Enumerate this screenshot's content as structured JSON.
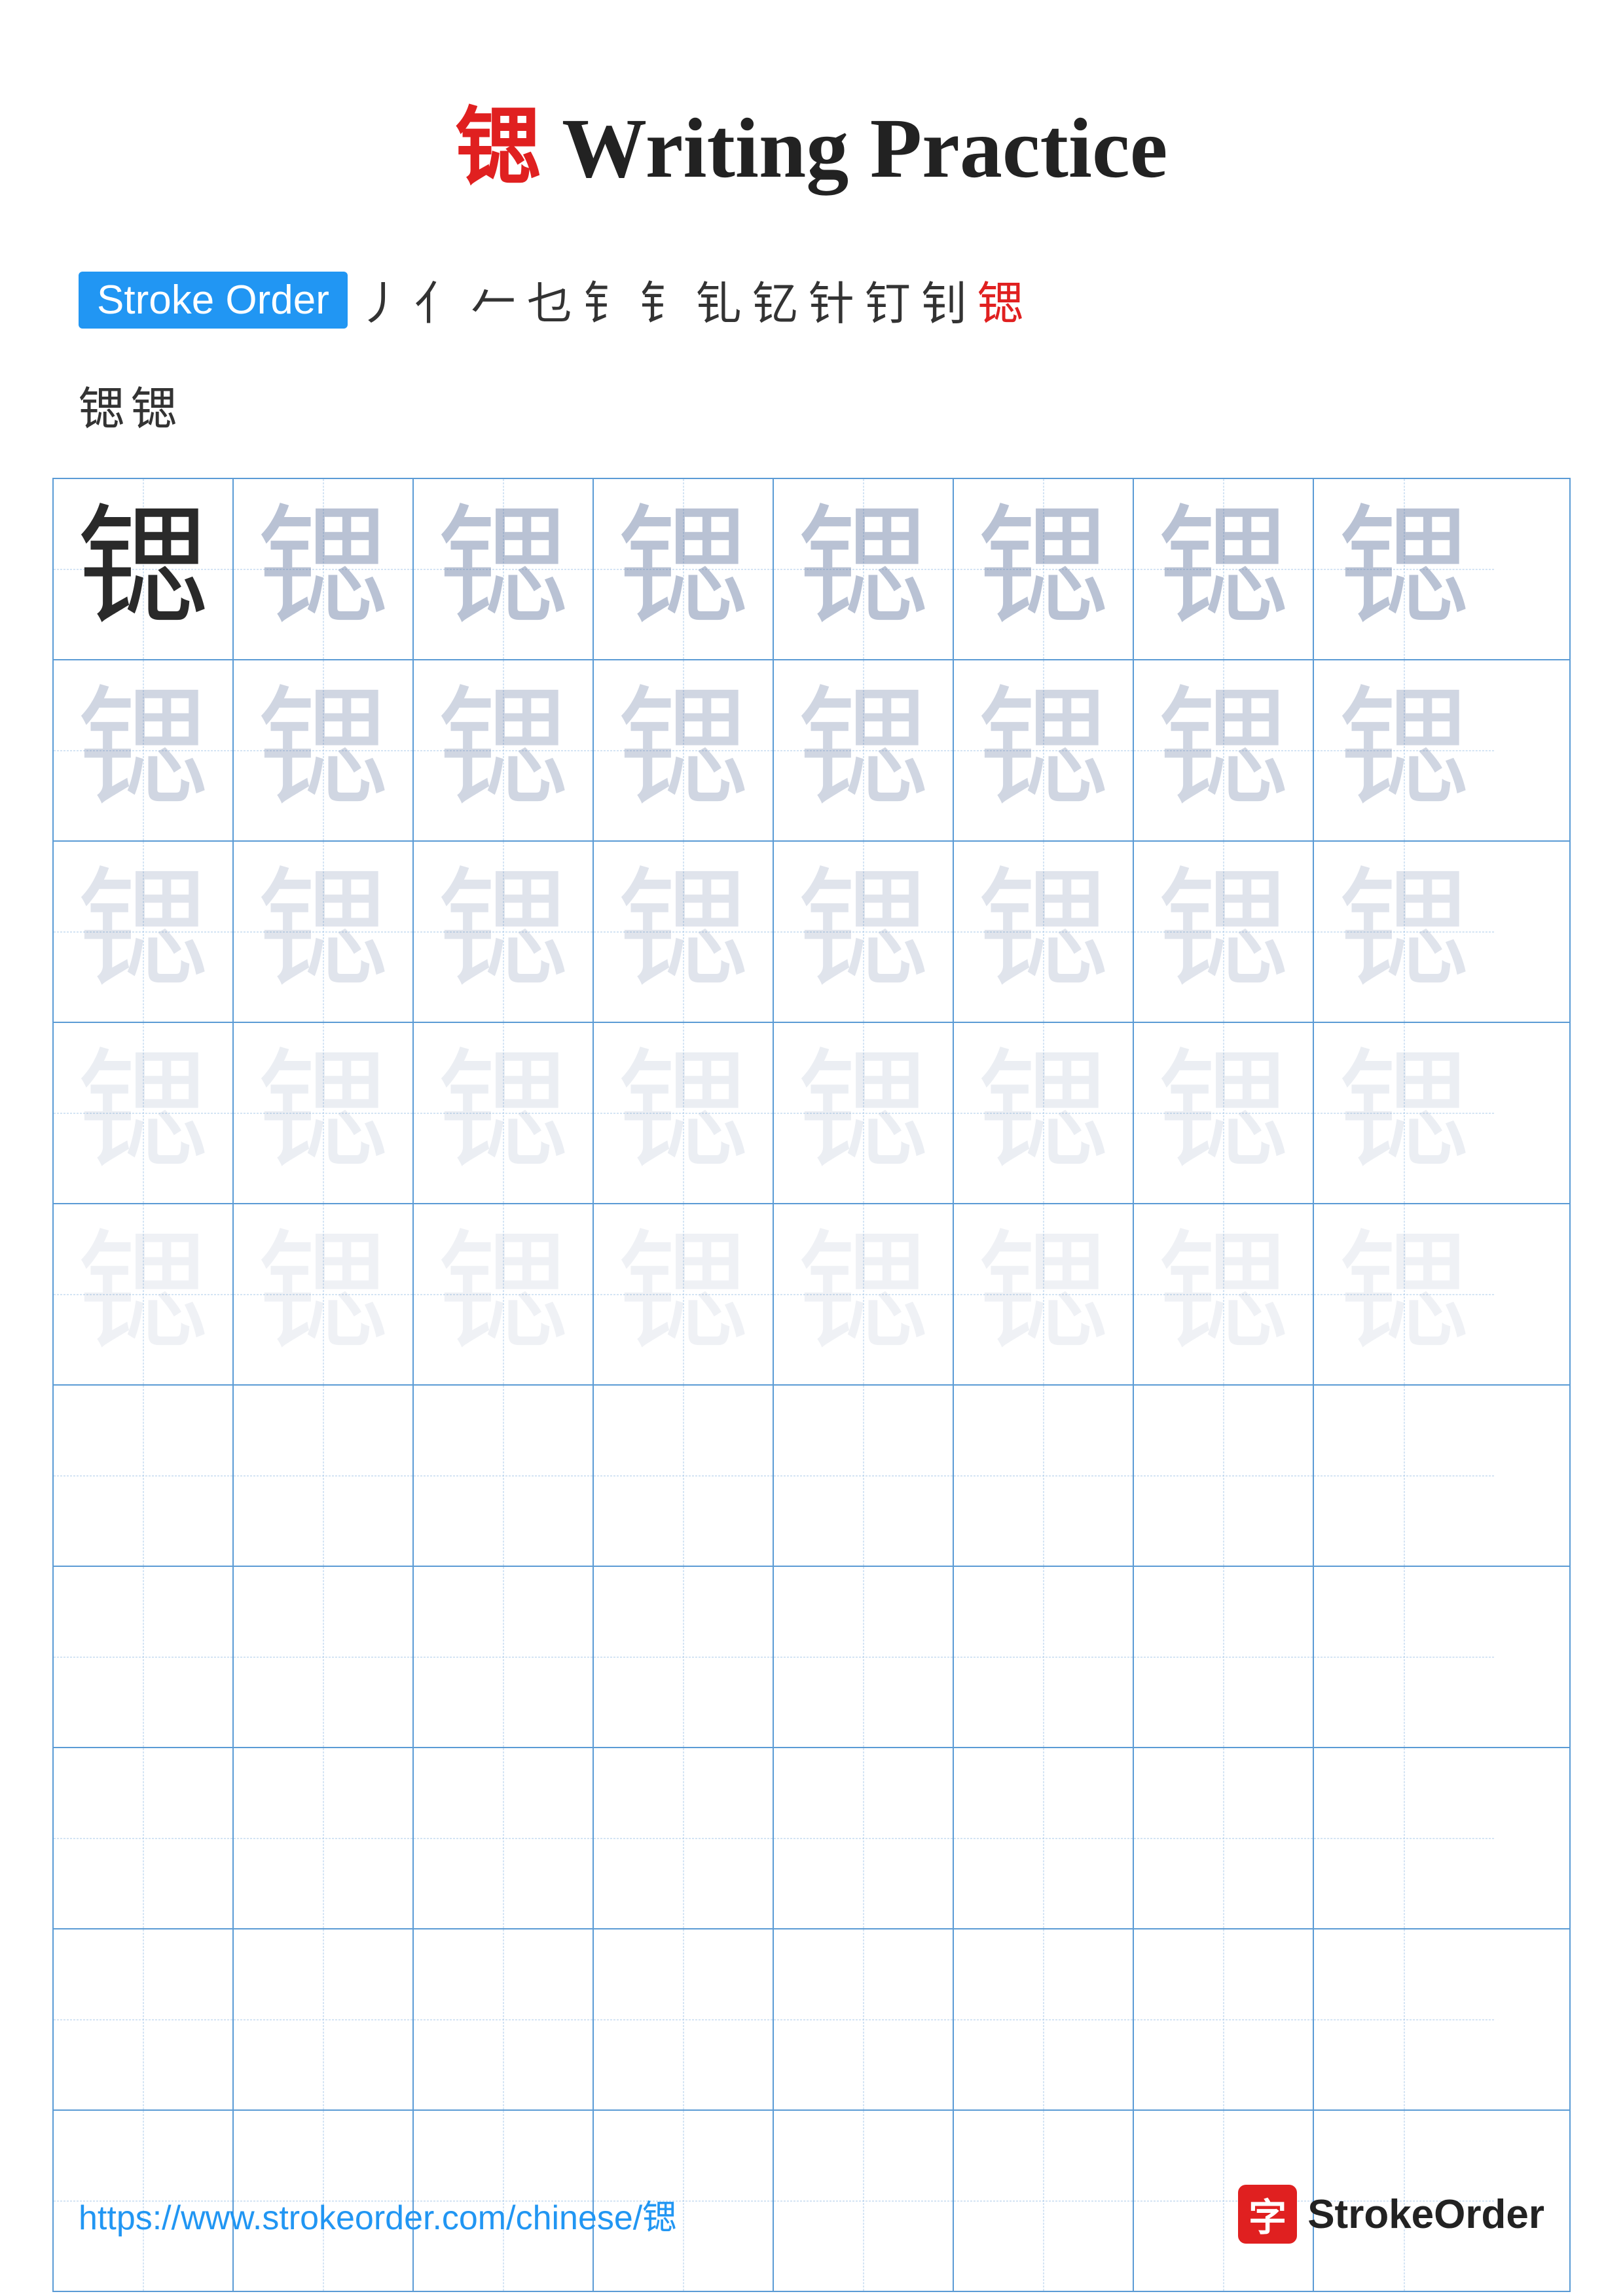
{
  "page": {
    "title_char": "锶",
    "title_text": " Writing Practice",
    "stroke_order_label": "Stroke Order",
    "stroke_sequence": [
      "丿",
      "亻",
      "𠂉",
      "乜",
      "钅",
      "钅",
      "钆",
      "钇",
      "针",
      "钉",
      "钊",
      "锶"
    ],
    "stroke_row2": [
      "锶",
      "锶"
    ],
    "practice_char": "锶",
    "footer_url": "https://www.strokeorder.com/chinese/锶",
    "brand_icon_char": "字",
    "brand_name": "StrokeOrder"
  }
}
